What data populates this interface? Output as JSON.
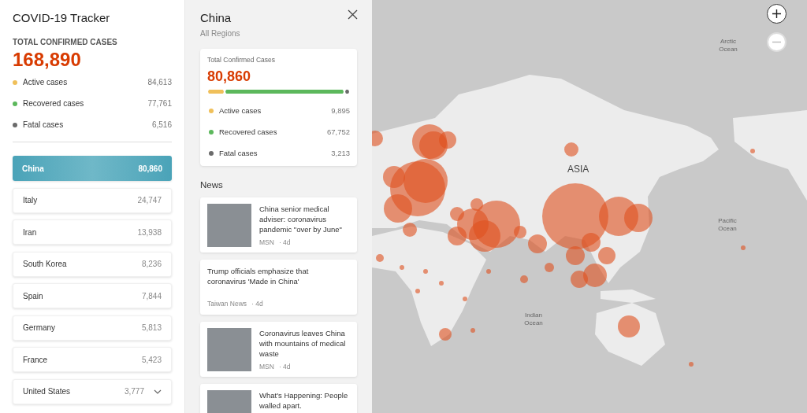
{
  "sidebar": {
    "title": "COVID-19 Tracker",
    "total_label": "TOTAL CONFIRMED CASES",
    "total": "168,890",
    "stats": [
      {
        "label": "Active cases",
        "value": "84,613",
        "color": "#f0c05a"
      },
      {
        "label": "Recovered cases",
        "value": "77,761",
        "color": "#5cb85c"
      },
      {
        "label": "Fatal cases",
        "value": "6,516",
        "color": "#6b6b6b"
      }
    ],
    "countries": [
      {
        "name": "China",
        "value": "80,860",
        "selected": true,
        "kind": "row"
      },
      {
        "name": "Italy",
        "value": "24,747",
        "selected": false,
        "kind": "row"
      },
      {
        "name": "Iran",
        "value": "13,938",
        "selected": false,
        "kind": "row"
      },
      {
        "name": "South Korea",
        "value": "8,236",
        "selected": false,
        "kind": "row"
      },
      {
        "name": "Spain",
        "value": "7,844",
        "selected": false,
        "kind": "row"
      },
      {
        "name": "Germany",
        "value": "5,813",
        "selected": false,
        "kind": "row"
      },
      {
        "name": "France",
        "value": "5,423",
        "selected": false,
        "kind": "row"
      },
      {
        "name": "United States",
        "value": "3,777",
        "selected": false,
        "kind": "dropdown"
      }
    ]
  },
  "detail": {
    "title": "China",
    "subtitle": "All Regions",
    "card_label": "Total Confirmed Cases",
    "total": "80,860",
    "stats": [
      {
        "label": "Active cases",
        "value": "9,895",
        "color": "#f0c05a"
      },
      {
        "label": "Recovered cases",
        "value": "67,752",
        "color": "#5cb85c"
      },
      {
        "label": "Fatal cases",
        "value": "3,213",
        "color": "#6b6b6b"
      }
    ],
    "news_heading": "News",
    "news": [
      {
        "kind": "with_image",
        "title": "China senior medical adviser: coronavirus pandemic \"over by June\"",
        "source": "MSN",
        "age": "· 4d"
      },
      {
        "kind": "text_only",
        "title": "Trump officials emphasize that coronavirus 'Made in China'",
        "source": "Taiwan News",
        "age": "· 4d"
      },
      {
        "kind": "with_image",
        "title": "Coronavirus leaves China with mountains of medical waste",
        "source": "MSN",
        "age": "· 4d"
      },
      {
        "kind": "with_image",
        "title": "What's Happening: People walled apart."
      }
    ]
  },
  "map": {
    "labels": [
      {
        "text": "Arctic Ocean",
        "kind": "ocean"
      },
      {
        "text": "ASIA",
        "kind": "continent"
      },
      {
        "text": "Pacific Ocean",
        "kind": "ocean"
      },
      {
        "text": "Indian Ocean",
        "kind": "ocean"
      }
    ]
  }
}
